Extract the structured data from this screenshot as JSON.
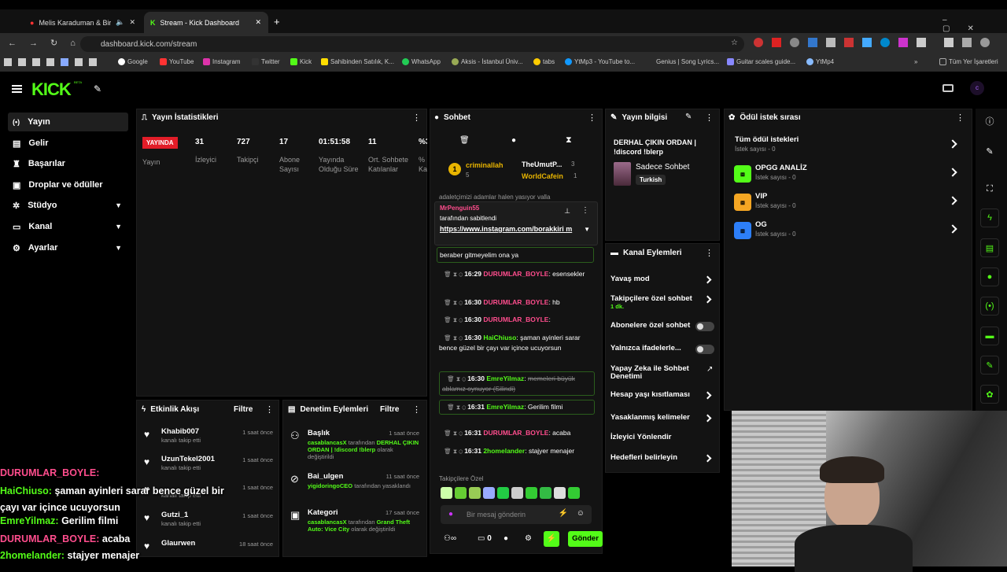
{
  "browser": {
    "tab1": "Melis Karaduman & Birkan",
    "tab2": "Stream - Kick Dashboard",
    "url": "dashboard.kick.com/stream",
    "bookmarks": [
      "Google",
      "YouTube",
      "Instagram",
      "Twitter",
      "Kick",
      "Sahibinden Satılık, K...",
      "WhatsApp",
      "Aksis - İstanbul Üniv...",
      "tabs",
      "YtMp3 - YouTube to...",
      "Genius | Song Lyrics...",
      "Guitar scales guide...",
      "YtMp4",
      "Tüm Yer İşaretleri"
    ],
    "colors": {
      "brand": "#53fc18",
      "live": "#e21d28"
    }
  },
  "logo": "KICK",
  "logo_beta": "BETA",
  "sidebar": {
    "items": [
      {
        "label": "Yayın",
        "icon": "broadcast-icon"
      },
      {
        "label": "Gelir",
        "icon": "wallet-icon"
      },
      {
        "label": "Başarılar",
        "icon": "trophy-icon"
      },
      {
        "label": "Droplar ve ödüller",
        "icon": "gift-icon"
      },
      {
        "label": "Stüdyo",
        "icon": "studio-icon"
      },
      {
        "label": "Kanal",
        "icon": "tv-icon"
      },
      {
        "label": "Ayarlar",
        "icon": "gear-icon"
      }
    ]
  },
  "stats": {
    "title": "Yayın İstatistikleri",
    "live": "YAYINDA",
    "live_label": "Yayın",
    "items": [
      {
        "value": "31",
        "label": "İzleyici"
      },
      {
        "value": "727",
        "label": "Takipçi"
      },
      {
        "value": "17",
        "label": "Abone Sayısı"
      },
      {
        "value": "01:51:58",
        "label": "Yayında Olduğu Süre"
      },
      {
        "value": "11",
        "label": "Ort. Sohbete Katılanlar"
      },
      {
        "value": "%3",
        "label": "% Ka"
      }
    ]
  },
  "activity": {
    "title": "Etkinlik Akışı",
    "filter": "Filtre",
    "items": [
      {
        "name": "Khabib007",
        "sub": "kanalı takip etti",
        "time": "1 saat önce"
      },
      {
        "name": "UzunTekel2001",
        "sub": "kanalı takip etti",
        "time": "1 saat önce"
      },
      {
        "name": "",
        "sub": "kanalı takip etti",
        "time": "1 saat önce"
      },
      {
        "name": "Gutzi_1",
        "sub": "kanalı takip etti",
        "time": "1 saat önce"
      },
      {
        "name": "Glaurwen",
        "sub": "",
        "time": "18 saat önce"
      }
    ]
  },
  "moderation": {
    "title": "Denetim Eylemleri",
    "filter": "Filtre",
    "items": [
      {
        "title": "Başlık",
        "time": "1 saat önce",
        "user": "casablancasX",
        "rest": "tarafından",
        "bold": "DERHAL ÇIKIN ORDAN | !discord !blerp",
        "tail": "olarak değiştirildi"
      },
      {
        "title": "Bai_ulgen",
        "time": "11 saat önce",
        "user": "yigidoringoCEO",
        "rest": "tarafından",
        "bold": "",
        "tail": "yasaklandı"
      },
      {
        "title": "Kategori",
        "time": "17 saat önce",
        "user": "casablancasX",
        "rest": "tarafından",
        "bold": "Grand Theft Auto: Vice City",
        "tail": "olarak değiştirildi"
      }
    ]
  },
  "chat": {
    "title": "Sohbet",
    "top": [
      {
        "rank": "1",
        "name": "criminallah",
        "count": "5"
      },
      {
        "name": "TheUmutP...",
        "count": "3"
      },
      {
        "name": "WorldCafein",
        "count": "1"
      }
    ],
    "cut_text": "adaletçimizi adamlar halen yasıyor valla",
    "pinned": {
      "user": "MrPenguin55",
      "by": "tarafından sabitlendi",
      "link": "https://www.instagram.com/borakkiri m"
    },
    "partial": "beraber gitmeyelim ona ya",
    "messages": [
      {
        "time": "16:29",
        "user": "DURUMLAR_BOYLE",
        "text": "esensekler",
        "color": "#ff4d8d"
      },
      {
        "time": "16:30",
        "user": "DURUMLAR_BOYLE",
        "text": "hb",
        "color": "#ff4d8d"
      },
      {
        "time": "16:30",
        "user": "DURUMLAR_BOYLE",
        "text": "",
        "color": "#ff4d8d"
      },
      {
        "time": "16:30",
        "user": "HaiChiuso",
        "text": "şaman ayinleri sarar bence güzel bir çayı var içince ucuyorsun",
        "color": "#53fc18"
      },
      {
        "time": "16:30",
        "user": "EmreYilmaz",
        "text": "memeleri büyük ablamız oynuyor (Silindi)",
        "color": "#53fc18"
      },
      {
        "time": "16:31",
        "user": "EmreYilmaz",
        "text": "Gerilim filmi",
        "color": "#53fc18"
      },
      {
        "time": "16:31",
        "user": "DURUMLAR_BOYLE",
        "text": "acaba",
        "color": "#ff4d8d"
      },
      {
        "time": "16:31",
        "user": "2homelander",
        "text": "stajyer menajer",
        "color": "#53fc18"
      }
    ],
    "followers_only": "Takipçilere Özel",
    "placeholder": "Bir mesaj gönderin",
    "send": "Gönder",
    "zero": "0"
  },
  "streaminfo": {
    "title": "Yayın bilgisi",
    "stream_title": "DERHAL ÇIKIN ORDAN | !discord !blerp",
    "category": "Sadece Sohbet",
    "tag": "Turkish"
  },
  "channel_actions": {
    "title": "Kanal Eylemleri",
    "items": [
      {
        "label": "Yavaş mod"
      },
      {
        "label": "Takipçilere özel sohbet",
        "sub": "1 dk."
      },
      {
        "label": "Abonelere özel sohbet"
      },
      {
        "label": "Yalnızca ifadelerle..."
      },
      {
        "label": "Yapay Zeka ile Sohbet Denetimi"
      },
      {
        "label": "Hesap yaşı kısıtlaması"
      },
      {
        "label": "Yasaklanmış kelimeler"
      },
      {
        "label": "İzleyici Yönlendir"
      },
      {
        "label": "Hedefleri belirleyin"
      }
    ]
  },
  "rewards": {
    "title": "Ödül istek sırası",
    "items": [
      {
        "name": "Tüm ödül istekleri",
        "count": "İstek sayısı - 0"
      },
      {
        "name": "OPGG ANALİZ",
        "count": "İstek sayısı - 0"
      },
      {
        "name": "VIP",
        "count": "İstek sayısı - 0"
      },
      {
        "name": "OG",
        "count": "İstek sayısı - 0"
      }
    ]
  },
  "overlay": [
    {
      "user": "DURUMLAR_BOYLE:",
      "text": "",
      "color": "#ff4d8d"
    },
    {
      "user": "HaiChiuso:",
      "text": "şaman ayinleri sarar bence güzel bir çayı var içince ucuyorsun",
      "color": "#53fc18"
    },
    {
      "user": "EmreYilmaz:",
      "text": "Gerilim filmi",
      "color": "#53fc18"
    },
    {
      "user": "DURUMLAR_BOYLE:",
      "text": "acaba",
      "color": "#ff4d8d"
    },
    {
      "user": "2homelander:",
      "text": "stajyer menajer",
      "color": "#53fc18"
    }
  ]
}
